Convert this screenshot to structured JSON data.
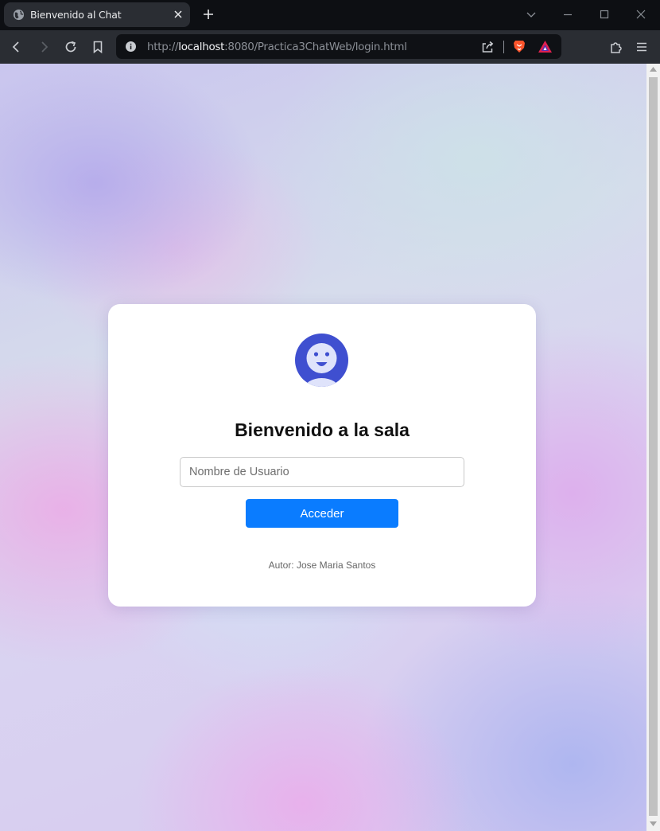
{
  "browser": {
    "tab_title": "Bienvenido al Chat",
    "url_prefix": "http://",
    "url_host": "localhost",
    "url_rest": ":8080/Practica3ChatWeb/login.html"
  },
  "icons": {
    "tab_favicon": "globe-icon",
    "tab_close": "close-icon",
    "new_tab": "plus-icon",
    "tab_list": "chevron-down-icon",
    "minimize": "minimize-icon",
    "maximize": "maximize-icon",
    "close_window": "close-icon",
    "back": "back-arrow-icon",
    "forward": "forward-arrow-icon",
    "reload": "reload-icon",
    "bookmark": "bookmark-icon",
    "site_info": "info-icon",
    "share": "share-icon",
    "brave_shields": "lion-icon",
    "rewards": "triangle-icon",
    "extensions": "puzzle-icon",
    "menu": "hamburger-icon",
    "avatar": "smiling-face-icon"
  },
  "login": {
    "heading": "Bienvenido a la sala",
    "username_placeholder": "Nombre de Usuario",
    "username_value": "",
    "submit_label": "Acceder",
    "author_text": "Autor: Jose Maria Santos"
  },
  "colors": {
    "primary_button": "#0a7cff",
    "avatar_bg": "#3f4fd0",
    "avatar_face": "#dfe3fb",
    "card_bg": "#ffffff"
  }
}
